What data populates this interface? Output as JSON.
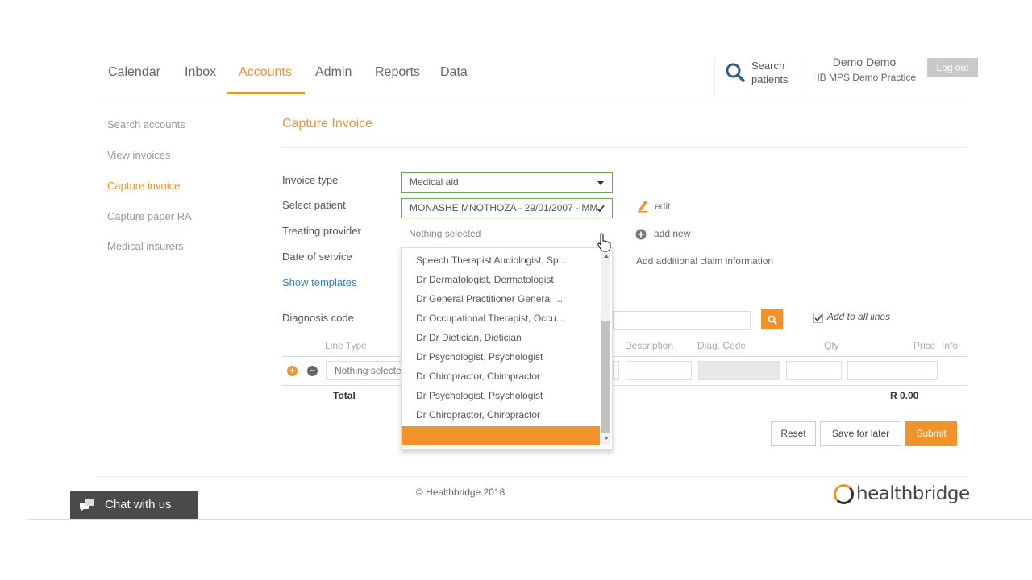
{
  "nav": {
    "items": [
      "Calendar",
      "Inbox",
      "Accounts",
      "Admin",
      "Reports",
      "Data"
    ],
    "active": "Accounts"
  },
  "header": {
    "search_label_line1": "Search",
    "search_label_line2": "patients",
    "user_name": "Demo Demo",
    "practice": "HB MPS Demo Practice",
    "logout_label": "Log out"
  },
  "sidebar": {
    "items": [
      "Search accounts",
      "View invoices",
      "Capture invoice",
      "Capture paper RA",
      "Medical insurers"
    ],
    "active": "Capture invoice"
  },
  "page": {
    "title": "Capture Invoice"
  },
  "form": {
    "invoice_type_label": "Invoice type",
    "invoice_type_value": "Medical aid",
    "select_patient_label": "Select patient",
    "select_patient_value": "MONASHE MNOTHOZA - 29/01/2007 - MM",
    "edit_label": "edit",
    "treating_provider_label": "Treating provider",
    "treating_provider_placeholder": "Nothing selected",
    "add_new_label": "add new",
    "date_of_service_label": "Date of service",
    "add_claim_label": "Add additional claim information",
    "show_templates_label": "Show templates",
    "diagnosis_code_label": "Diagnosis code",
    "add_to_all_lines_label": "Add to all lines"
  },
  "dropdown": {
    "options": [
      "Speech Therapist Audiologist, Sp...",
      "Dr Dermatologist, Dermatologist",
      "Dr General Practitioner General ...",
      "Dr Occupational Therapist, Occu...",
      "Dr Dr Dietician, Dietician",
      "Dr Psychologist, Psychologist",
      "Dr Chiropractor, Chiropractor",
      "Dr Psychologist, Psychologist",
      "Dr Chiropractor, Chiropractor"
    ]
  },
  "table": {
    "headers": [
      "Line Type",
      "Description",
      "Diag. Code",
      "Qty",
      "Price",
      "Info"
    ],
    "line_type_value": "Nothing selected",
    "total_label": "Total",
    "total_value": "R 0.00"
  },
  "buttons": {
    "reset": "Reset",
    "save_for_later": "Save for later",
    "submit": "Submit"
  },
  "footer": {
    "copyright": "© Healthbridge 2018",
    "brand": "healthbridge",
    "chat_label": "Chat with us"
  },
  "colors": {
    "accent": "#f0932b",
    "valid_border": "#6aa84f",
    "link": "#3a7ec2"
  }
}
